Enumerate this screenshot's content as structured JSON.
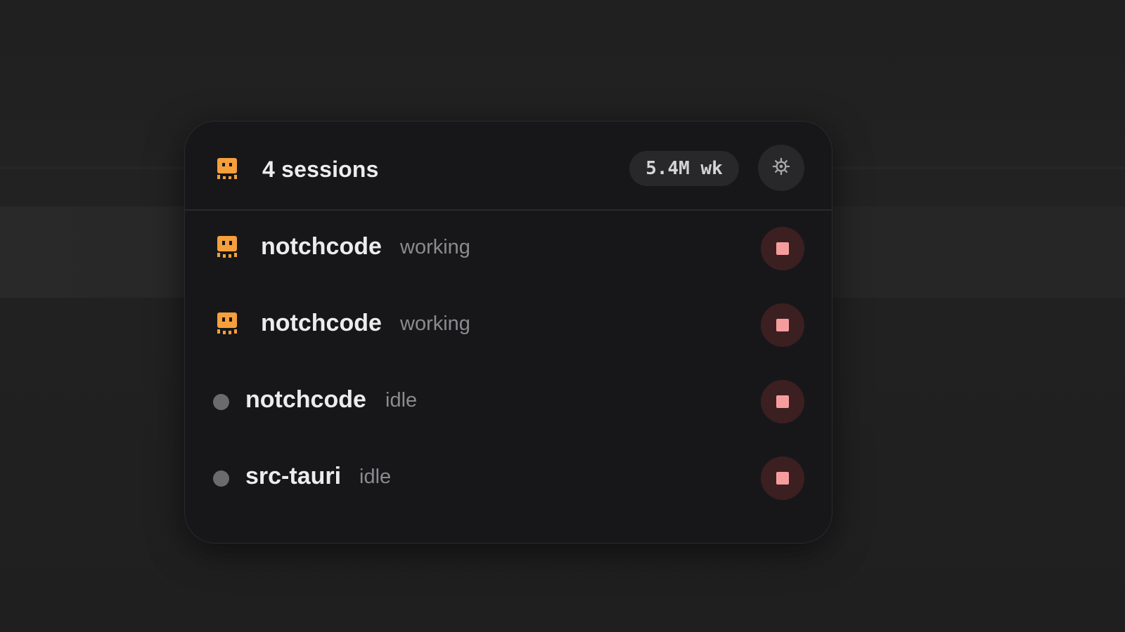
{
  "header": {
    "title": "4 sessions",
    "usage_badge": "5.4M wk",
    "mascot_icon": "orange-robot-icon",
    "settings_icon": "gear-icon"
  },
  "sessions": [
    {
      "name": "notchcode",
      "status": "working",
      "indicator": "orange-robot-icon",
      "action_icon": "stop-icon"
    },
    {
      "name": "notchcode",
      "status": "working",
      "indicator": "orange-robot-icon",
      "action_icon": "stop-icon"
    },
    {
      "name": "notchcode",
      "status": "idle",
      "indicator": "gray-dot",
      "action_icon": "stop-icon"
    },
    {
      "name": "src-tauri",
      "status": "idle",
      "indicator": "gray-dot",
      "action_icon": "stop-icon"
    }
  ],
  "colors": {
    "accent": "#f5a03c",
    "idle_dot": "#6b6b6e",
    "stop_button_bg": "#3c1f21",
    "stop_icon": "#f59d9d",
    "panel_bg": "#17171a"
  }
}
